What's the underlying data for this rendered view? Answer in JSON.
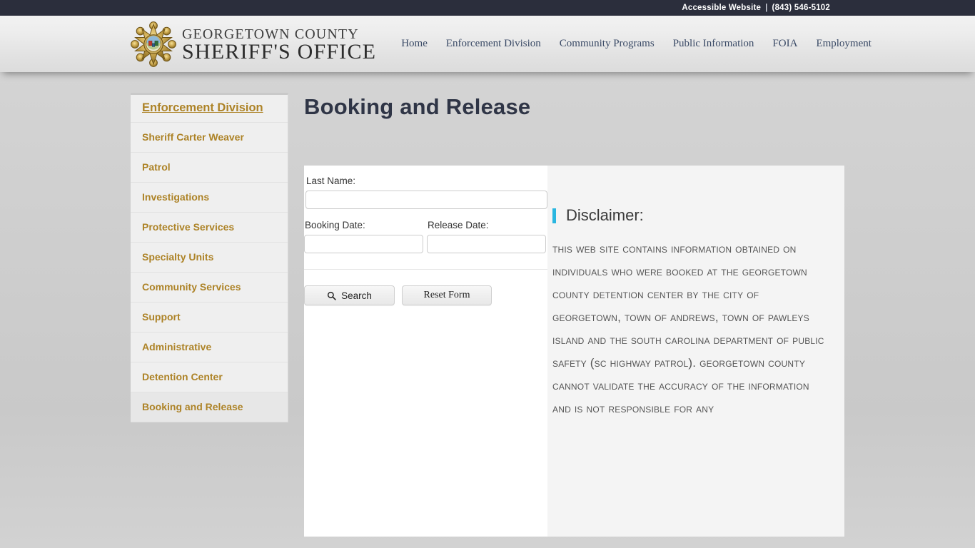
{
  "topbar": {
    "accessible_label": "Accessible Website",
    "separator": "|",
    "phone": "(843) 546-5102"
  },
  "header": {
    "brand_line1": "GEORGETOWN COUNTY",
    "brand_line2": "SHERIFF'S OFFICE",
    "nav": [
      {
        "label": "Home"
      },
      {
        "label": "Enforcement Division"
      },
      {
        "label": "Community Programs"
      },
      {
        "label": "Public Information"
      },
      {
        "label": "FOIA"
      },
      {
        "label": "Employment"
      }
    ]
  },
  "sidebar": {
    "items": [
      {
        "label": "Enforcement Division",
        "heading": true,
        "active": false
      },
      {
        "label": "Sheriff Carter Weaver",
        "heading": false,
        "active": false
      },
      {
        "label": "Patrol",
        "heading": false,
        "active": false
      },
      {
        "label": "Investigations",
        "heading": false,
        "active": false
      },
      {
        "label": "Protective Services",
        "heading": false,
        "active": false
      },
      {
        "label": "Specialty Units",
        "heading": false,
        "active": false
      },
      {
        "label": "Community Services",
        "heading": false,
        "active": false
      },
      {
        "label": "Support",
        "heading": false,
        "active": false
      },
      {
        "label": "Administrative",
        "heading": false,
        "active": false
      },
      {
        "label": "Detention Center",
        "heading": false,
        "active": false
      },
      {
        "label": "Booking and Release",
        "heading": false,
        "active": true
      }
    ]
  },
  "main": {
    "title": "Booking and Release",
    "form": {
      "last_name_label": "Last Name:",
      "last_name_value": "",
      "booking_date_label": "Booking Date:",
      "booking_date_value": "",
      "release_date_label": "Release Date:",
      "release_date_value": "",
      "search_button": "Search",
      "reset_button": "Reset Form"
    },
    "disclaimer": {
      "heading": "Disclaimer:",
      "body": "This web site contains information obtained on individuals who were booked at the Georgetown County Detention Center by the City of Georgetown, Town of Andrews, Town of Pawleys Island and the South Carolina Department of Public Safety (SC Highway Patrol). Georgetown County cannot validate the accuracy of the information and is not responsible for any"
    }
  },
  "colors": {
    "topbar_bg": "#2b2e3c",
    "sidebar_link": "#ad8327",
    "title": "#2f3546",
    "nav_link": "#3a4a66",
    "accent_bar": "#29b6e0"
  }
}
